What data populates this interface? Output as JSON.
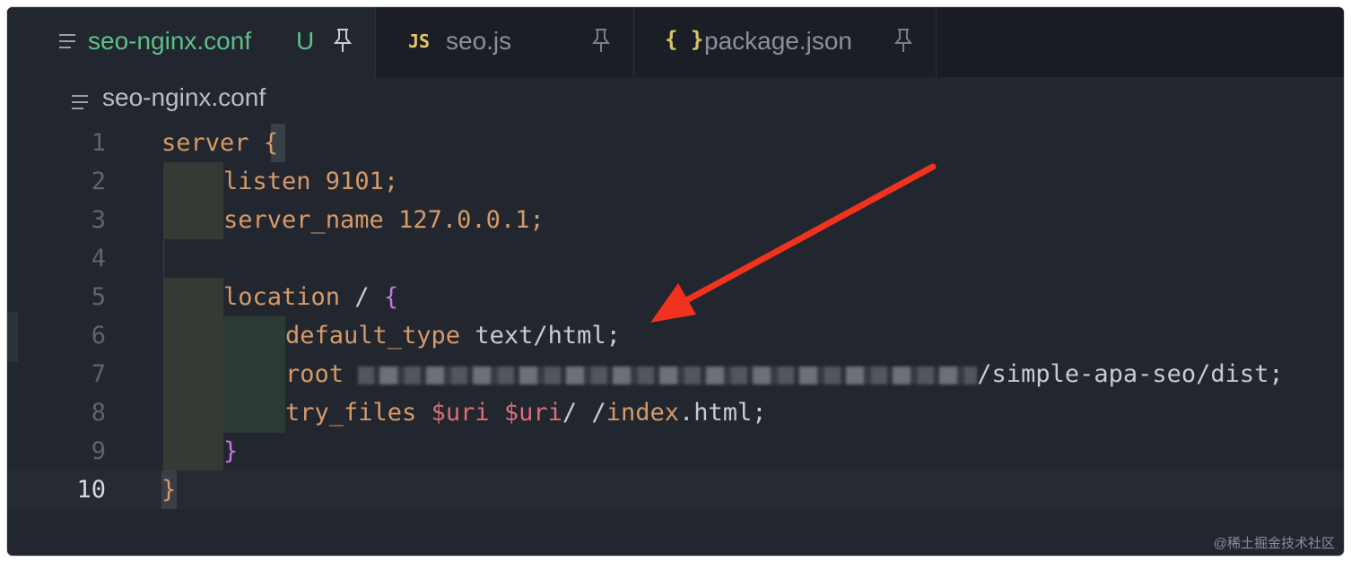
{
  "tabs": [
    {
      "icon": "menu-lines-icon",
      "label": "seo-nginx.conf",
      "status": "U",
      "active": true
    },
    {
      "icon_text": "JS",
      "label": "seo.js",
      "active": false
    },
    {
      "icon_text": "{ }",
      "label": "package.json",
      "active": false
    }
  ],
  "breadcrumb": {
    "label": "seo-nginx.conf"
  },
  "editor": {
    "current_line": 10,
    "line_numbers": [
      "1",
      "2",
      "3",
      "4",
      "5",
      "6",
      "7",
      "8",
      "9",
      "10"
    ],
    "code": {
      "l1_kw": "server",
      "l1_brace": "{",
      "l2_kw": "listen",
      "l2_rest": " 9101;",
      "l3_kw": "server_name",
      "l3_rest": " 127.0.0.1;",
      "l5_kw": "location",
      "l5_mid": " / ",
      "l5_brace": "{",
      "l6_kw": "default_type",
      "l6_rest": " text/html;",
      "l7_kw": "root",
      "l7_rest": "/simple-apa-seo/dist;",
      "l8_kw": "try_files",
      "l8_var1": "$uri",
      "l8_var2": "$uri",
      "l8_rest1": "/ /",
      "l8_kw2": "index",
      "l8_rest2": ".html;",
      "l9_brace": "}",
      "l10_brace": "}"
    }
  },
  "watermark": "@稀土掘金技术社区",
  "colors": {
    "background": "#22262e",
    "keyword": "#d59a68",
    "bracket_purple": "#c678dd",
    "variable": "#e06c75",
    "annotation_arrow": "#f0321e"
  }
}
